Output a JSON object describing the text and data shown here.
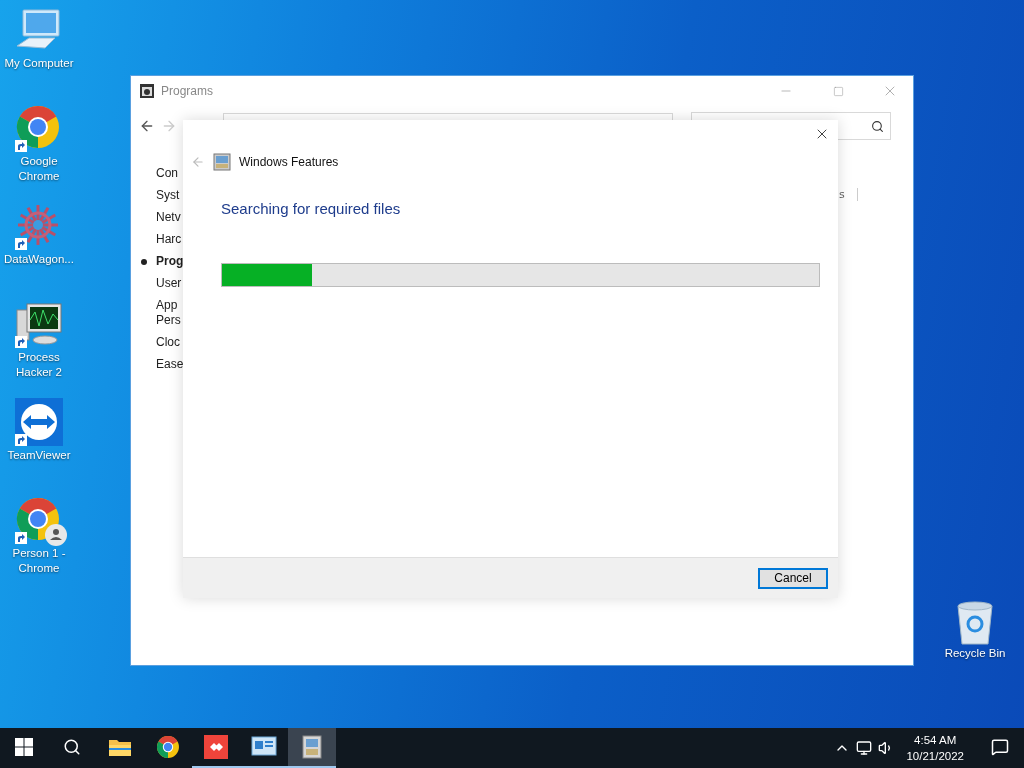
{
  "desktop_icons": [
    {
      "label": "My Computer",
      "kind": "computer",
      "shortcut": false
    },
    {
      "label": "Google Chrome",
      "kind": "chrome",
      "shortcut": true
    },
    {
      "label": "DataWagon...",
      "kind": "burst",
      "shortcut": true
    },
    {
      "label": "Process Hacker 2",
      "kind": "monitor",
      "shortcut": true
    },
    {
      "label": "TeamViewer",
      "kind": "arrows",
      "shortcut": true
    },
    {
      "label": "Person 1 - Chrome",
      "kind": "chrome-person",
      "shortcut": true
    }
  ],
  "recycle_bin": {
    "label": "Recycle Bin"
  },
  "programs_window": {
    "title": "Programs",
    "nav_items": [
      {
        "label": "Con",
        "selected": false
      },
      {
        "label": "Syst",
        "selected": false
      },
      {
        "label": "Netv",
        "selected": false
      },
      {
        "label": "Harc",
        "selected": false
      },
      {
        "label": "Prog",
        "selected": true
      },
      {
        "label": "User",
        "selected": false
      },
      {
        "label": "App\nPers",
        "selected": false
      },
      {
        "label": "Cloc",
        "selected": false
      },
      {
        "label": "Ease",
        "selected": false
      }
    ],
    "fragment": "s"
  },
  "features_dialog": {
    "title": "Windows Features",
    "heading": "Searching for required files",
    "progress": {
      "level": 0.15
    },
    "buttons": [
      "Cancel"
    ]
  },
  "taskbar": {
    "apps": [
      {
        "kind": "folder",
        "running": false,
        "active": false
      },
      {
        "kind": "chrome",
        "running": false,
        "active": false
      },
      {
        "kind": "remote",
        "running": true,
        "active": false
      },
      {
        "kind": "panel",
        "running": true,
        "active": false
      },
      {
        "kind": "features",
        "running": true,
        "active": true
      }
    ],
    "time": "4:54 AM",
    "date": "10/21/2022"
  }
}
